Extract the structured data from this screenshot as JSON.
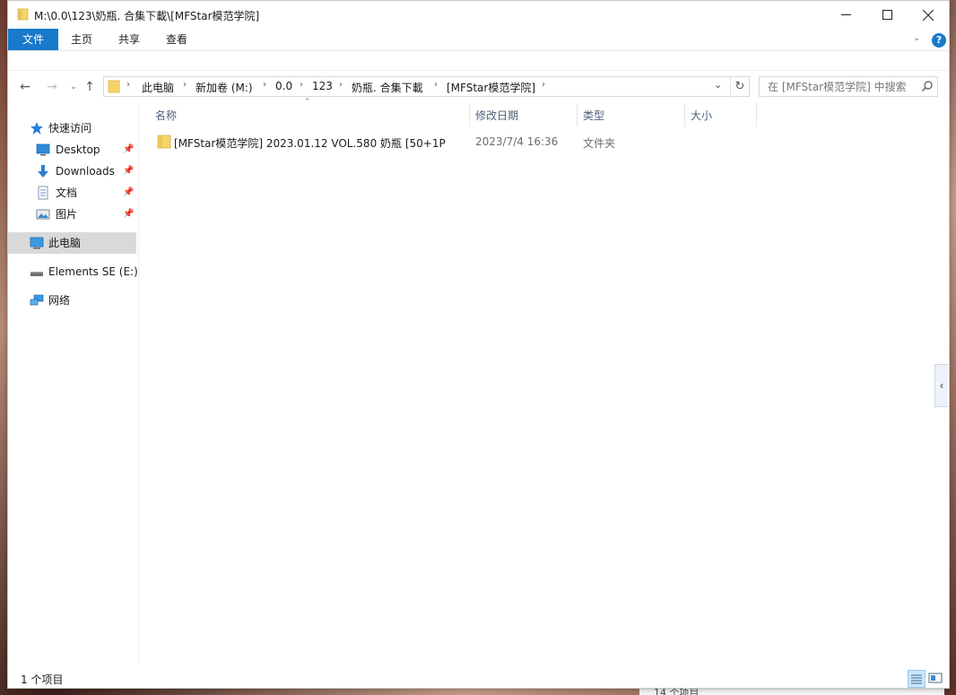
{
  "window": {
    "title": "M:\\0.0\\123\\奶瓶. 合集下載\\[MFStar模范学院]"
  },
  "ribbon": {
    "tabs": [
      "文件",
      "主页",
      "共享",
      "查看"
    ],
    "help": "?"
  },
  "address": {
    "crumbs": [
      "此电脑",
      "新加卷 (M:)",
      "0.0",
      "123",
      "奶瓶. 合集下載",
      "[MFStar模范学院]"
    ],
    "search_placeholder": "在 [MFStar模范学院] 中搜索"
  },
  "nav": {
    "quick_access": "快速访问",
    "items": [
      {
        "label": "Desktop",
        "icon": "desktop-icon",
        "pinned": true
      },
      {
        "label": "Downloads",
        "icon": "downloads-icon",
        "pinned": true
      },
      {
        "label": "文档",
        "icon": "documents-icon",
        "pinned": true
      },
      {
        "label": "图片",
        "icon": "pictures-icon",
        "pinned": true
      }
    ],
    "this_pc": "此电脑",
    "drive": "Elements SE (E:)",
    "network": "网络"
  },
  "columns": {
    "name": "名称",
    "date": "修改日期",
    "type": "类型",
    "size": "大小"
  },
  "files": [
    {
      "name": "[MFStar模范学院] 2023.01.12 VOL.580 奶瓶 [50+1P",
      "date": "2023/7/4 16:36",
      "type": "文件夹",
      "size": ""
    }
  ],
  "status": {
    "count": "1 个项目"
  },
  "background_window": {
    "status": "14 个项目"
  },
  "colors": {
    "accent": "#1979ca",
    "folder": "#f6d36b",
    "selected_nav": "#d9d9d9",
    "header_text": "#4c607a"
  }
}
